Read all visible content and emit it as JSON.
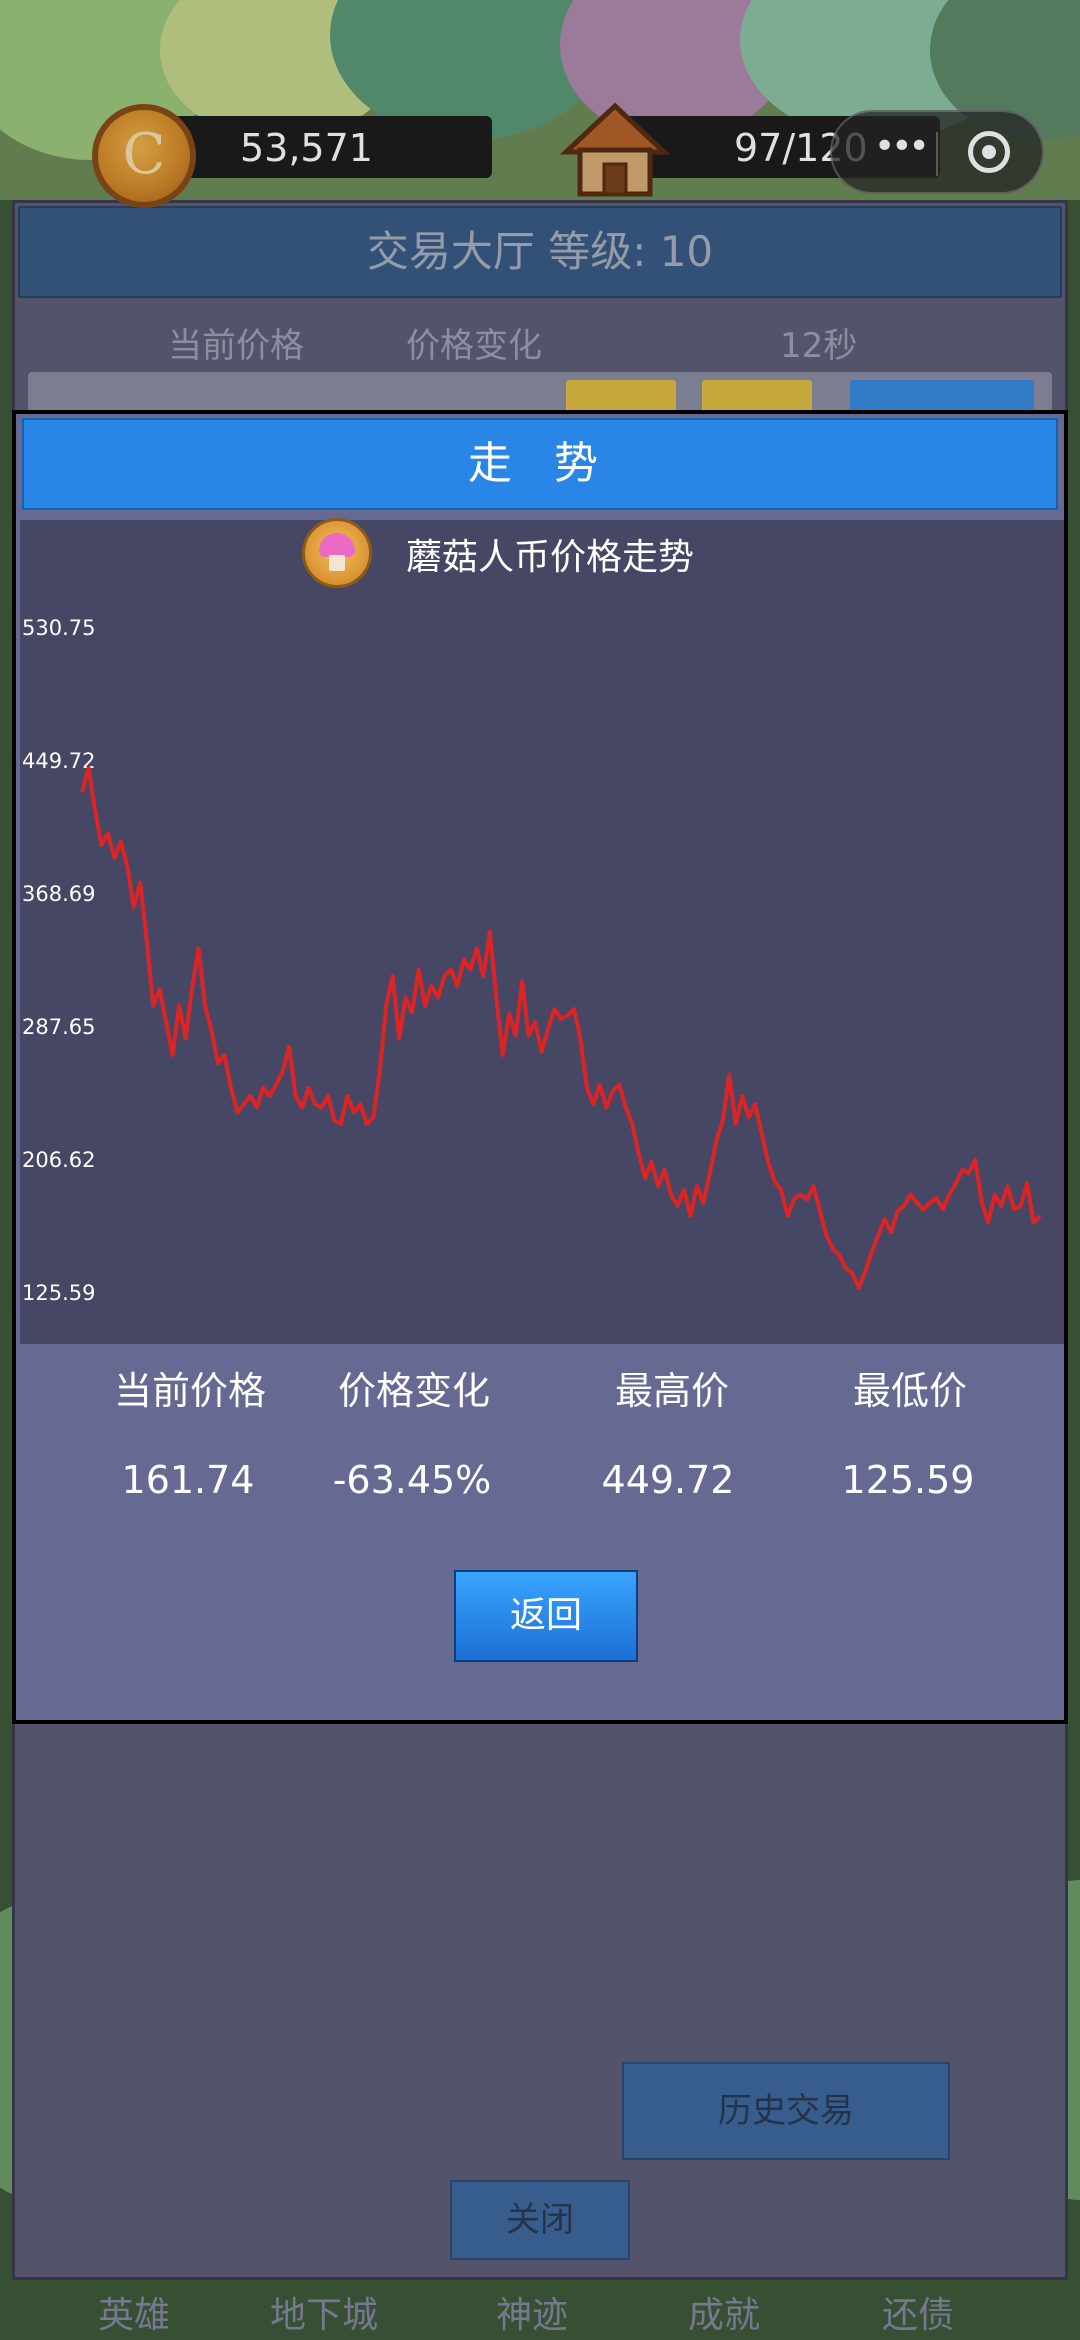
{
  "hud": {
    "coin_symbol": "C",
    "coins": "53,571",
    "energy": "97/120"
  },
  "hall": {
    "title": "交易大厅 等级: 10",
    "col_price": "当前价格",
    "col_change": "价格变化",
    "timer": "12秒"
  },
  "trend_modal": {
    "header": "走 势",
    "chart_title": "蘑菇人币价格走势",
    "stats": {
      "current_label": "当前价格",
      "change_label": "价格变化",
      "high_label": "最高价",
      "low_label": "最低价",
      "current_value": "161.74",
      "change_value": "-63.45%",
      "high_value": "449.72",
      "low_value": "125.59"
    },
    "back_label": "返回"
  },
  "bottom_buttons": {
    "history": "历史交易",
    "close": "关闭"
  },
  "tabs": [
    "英雄",
    "地下城",
    "神迹",
    "成就",
    "还债"
  ],
  "colors": {
    "line": "#dd2424",
    "modal_header": "#2a86e6",
    "chart_bg": "#464764",
    "panel_bg": "#666a93"
  },
  "chart_data": {
    "type": "line",
    "title": "蘑菇人币价格走势",
    "ylim": [
      125.59,
      530.75
    ],
    "y_ticks": [
      "530.75",
      "449.72",
      "368.69",
      "287.65",
      "206.62",
      "125.59"
    ],
    "y_tick_values": [
      530.75,
      449.72,
      368.69,
      287.65,
      206.62,
      125.59
    ],
    "series": [
      {
        "values": [
          430,
          445,
          420,
          398,
          405,
          390,
          400,
          385,
          360,
          375,
          340,
          300,
          310,
          290,
          270,
          300,
          280,
          310,
          335,
          300,
          285,
          265,
          270,
          250,
          235,
          240,
          245,
          238,
          250,
          245,
          252,
          260,
          275,
          245,
          238,
          250,
          240,
          238,
          245,
          230,
          228,
          245,
          235,
          240,
          228,
          232,
          260,
          300,
          318,
          280,
          305,
          296,
          322,
          300,
          312,
          305,
          318,
          322,
          312,
          328,
          322,
          335,
          318,
          345,
          305,
          270,
          295,
          282,
          315,
          282,
          290,
          272,
          286,
          298,
          292,
          294,
          298,
          280,
          250,
          240,
          252,
          238,
          248,
          252,
          238,
          228,
          210,
          195,
          205,
          190,
          200,
          185,
          178,
          188,
          172,
          190,
          180,
          198,
          218,
          230,
          258,
          228,
          245,
          232,
          240,
          222,
          205,
          193,
          188,
          172,
          182,
          185,
          182,
          190,
          175,
          160,
          152,
          148,
          140,
          137,
          128,
          138,
          150,
          160,
          170,
          162,
          175,
          178,
          185,
          180,
          176,
          180,
          183,
          176,
          185,
          192,
          200,
          198,
          206,
          180,
          168,
          185,
          178,
          190,
          176,
          178,
          192,
          168,
          172
        ]
      }
    ]
  }
}
